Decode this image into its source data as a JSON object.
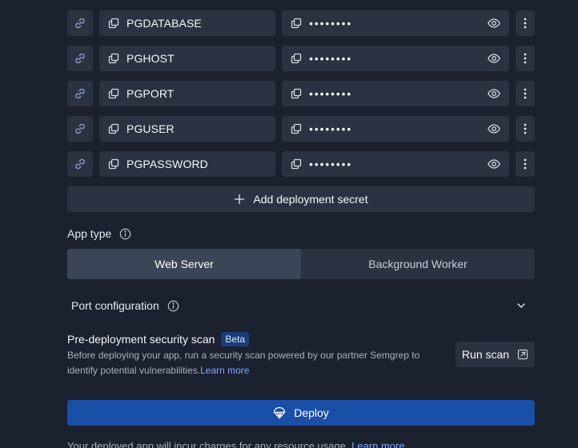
{
  "secrets": [
    {
      "key": "PGDATABASE",
      "masked": "••••••••"
    },
    {
      "key": "PGHOST",
      "masked": "••••••••"
    },
    {
      "key": "PGPORT",
      "masked": "••••••••"
    },
    {
      "key": "PGUSER",
      "masked": "••••••••"
    },
    {
      "key": "PGPASSWORD",
      "masked": "••••••••"
    }
  ],
  "add_secret_label": "Add deployment secret",
  "app_type": {
    "label": "App type",
    "options": [
      "Web Server",
      "Background Worker"
    ],
    "selected": "Web Server"
  },
  "port_config_label": "Port configuration",
  "security_scan": {
    "title": "Pre-deployment security scan",
    "badge": "Beta",
    "description": "Before deploying your app, run a security scan powered by our partner Semgrep to identify potential vulnerabilities.",
    "learn_more": "Learn more",
    "run_label": "Run scan"
  },
  "deploy_label": "Deploy",
  "footnote": {
    "text": "Your deployed app will incur charges for any resource usage.",
    "link": "Learn more"
  },
  "colors": {
    "background": "#1c2130",
    "surface": "#2b3242",
    "primary": "#1a4fa8",
    "link": "#7fa7ff"
  },
  "icons": {
    "link": "link-icon",
    "copy": "copy-icon",
    "eye": "eye-icon",
    "more": "more-vertical-icon",
    "plus": "plus-icon",
    "info": "info-icon",
    "chevron": "chevron-down-icon",
    "external": "external-link-icon",
    "deploy": "deploy-icon"
  }
}
